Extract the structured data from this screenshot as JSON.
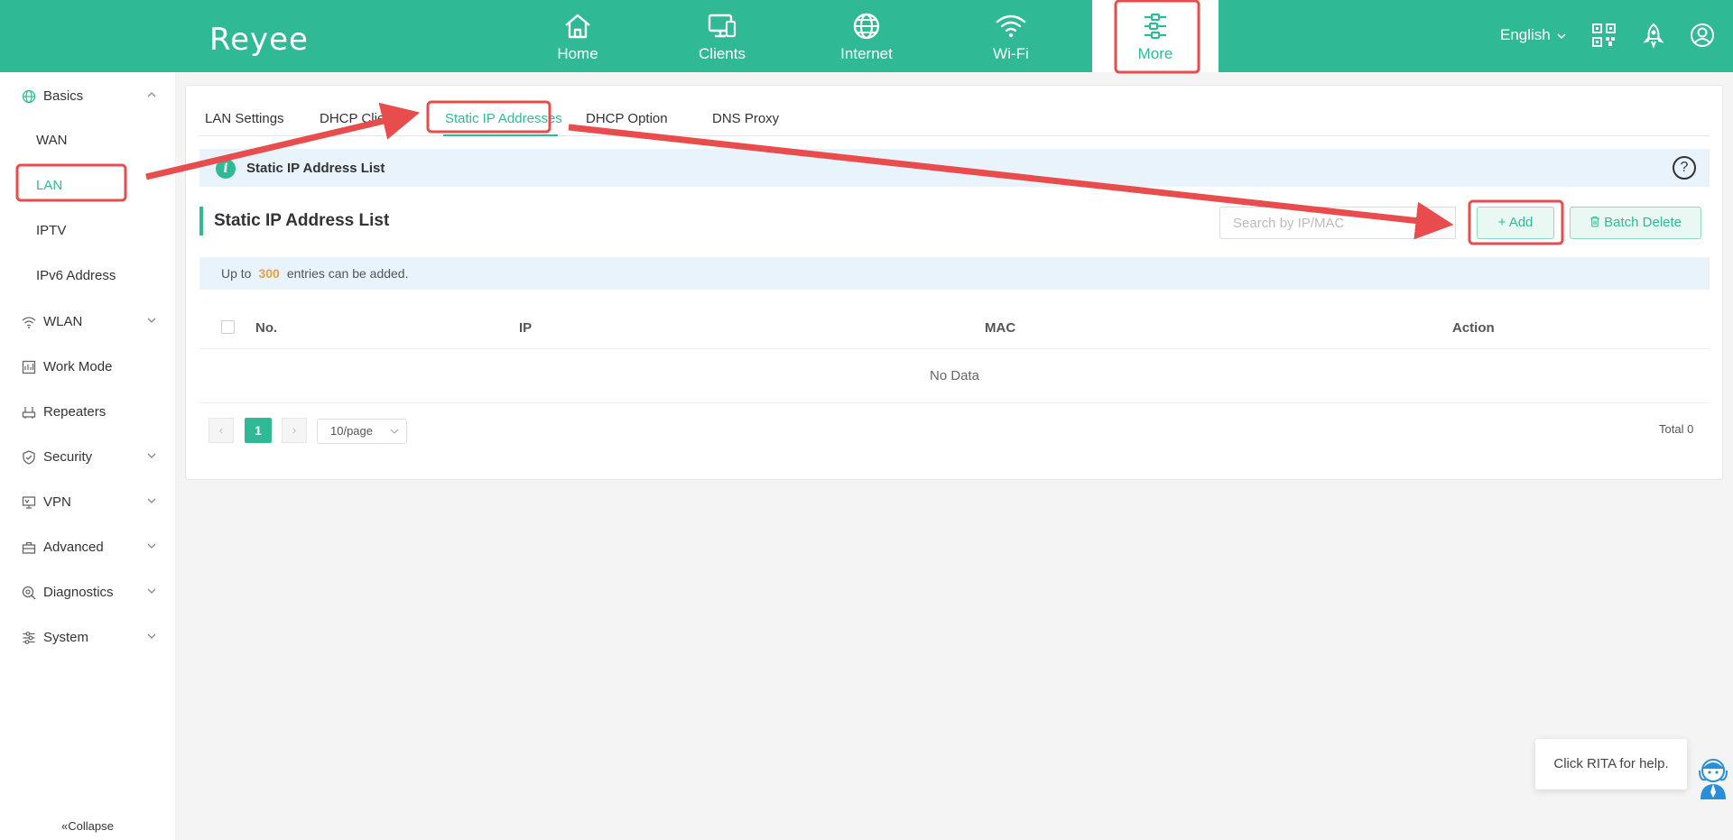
{
  "header": {
    "logo": "Reyee",
    "nav": [
      {
        "label": "Home",
        "icon": "home-icon"
      },
      {
        "label": "Clients",
        "icon": "clients-icon"
      },
      {
        "label": "Internet",
        "icon": "globe-icon"
      },
      {
        "label": "Wi-Fi",
        "icon": "wifi-icon"
      },
      {
        "label": "More",
        "icon": "more-sliders-icon",
        "active": true
      }
    ],
    "language": "English",
    "icons": [
      "qr-code-icon",
      "rocket-icon",
      "user-icon"
    ]
  },
  "sidebar": {
    "groups": [
      {
        "label": "Basics",
        "icon": "globe-icon",
        "expanded": true,
        "items": [
          "WAN",
          "LAN",
          "IPTV",
          "IPv6 Address"
        ],
        "active_item": "LAN"
      },
      {
        "label": "WLAN",
        "icon": "wifi-icon"
      },
      {
        "label": "Work Mode",
        "icon": "work-mode-icon"
      },
      {
        "label": "Repeaters",
        "icon": "repeater-icon"
      },
      {
        "label": "Security",
        "icon": "shield-icon"
      },
      {
        "label": "VPN",
        "icon": "vpn-icon"
      },
      {
        "label": "Advanced",
        "icon": "toolbox-icon"
      },
      {
        "label": "Diagnostics",
        "icon": "diagnostics-icon"
      },
      {
        "label": "System",
        "icon": "system-icon"
      }
    ],
    "collapse_label": "Collapse"
  },
  "tabs": [
    "LAN Settings",
    "DHCP Clients",
    "Static IP Addresses",
    "DHCP Option",
    "DNS Proxy"
  ],
  "active_tab": "Static IP Addresses",
  "info_bar": {
    "title": "Static IP Address List"
  },
  "section": {
    "title": "Static IP Address List",
    "search_placeholder": "Search by IP/MAC",
    "add_label": "Add",
    "batch_delete_label": "Batch Delete"
  },
  "notice": {
    "prefix": "Up to",
    "count": "300",
    "suffix": "entries can be added."
  },
  "table": {
    "columns": [
      "No.",
      "IP",
      "MAC",
      "Action"
    ],
    "empty_text": "No Data"
  },
  "pagination": {
    "current_page": "1",
    "page_size": "10/page",
    "total": "Total 0"
  },
  "help": {
    "rita_text": "Click RITA for help."
  },
  "colors": {
    "brand": "#2fba95",
    "highlight": "#e84c4c",
    "info_bg": "#e8f3fb"
  }
}
